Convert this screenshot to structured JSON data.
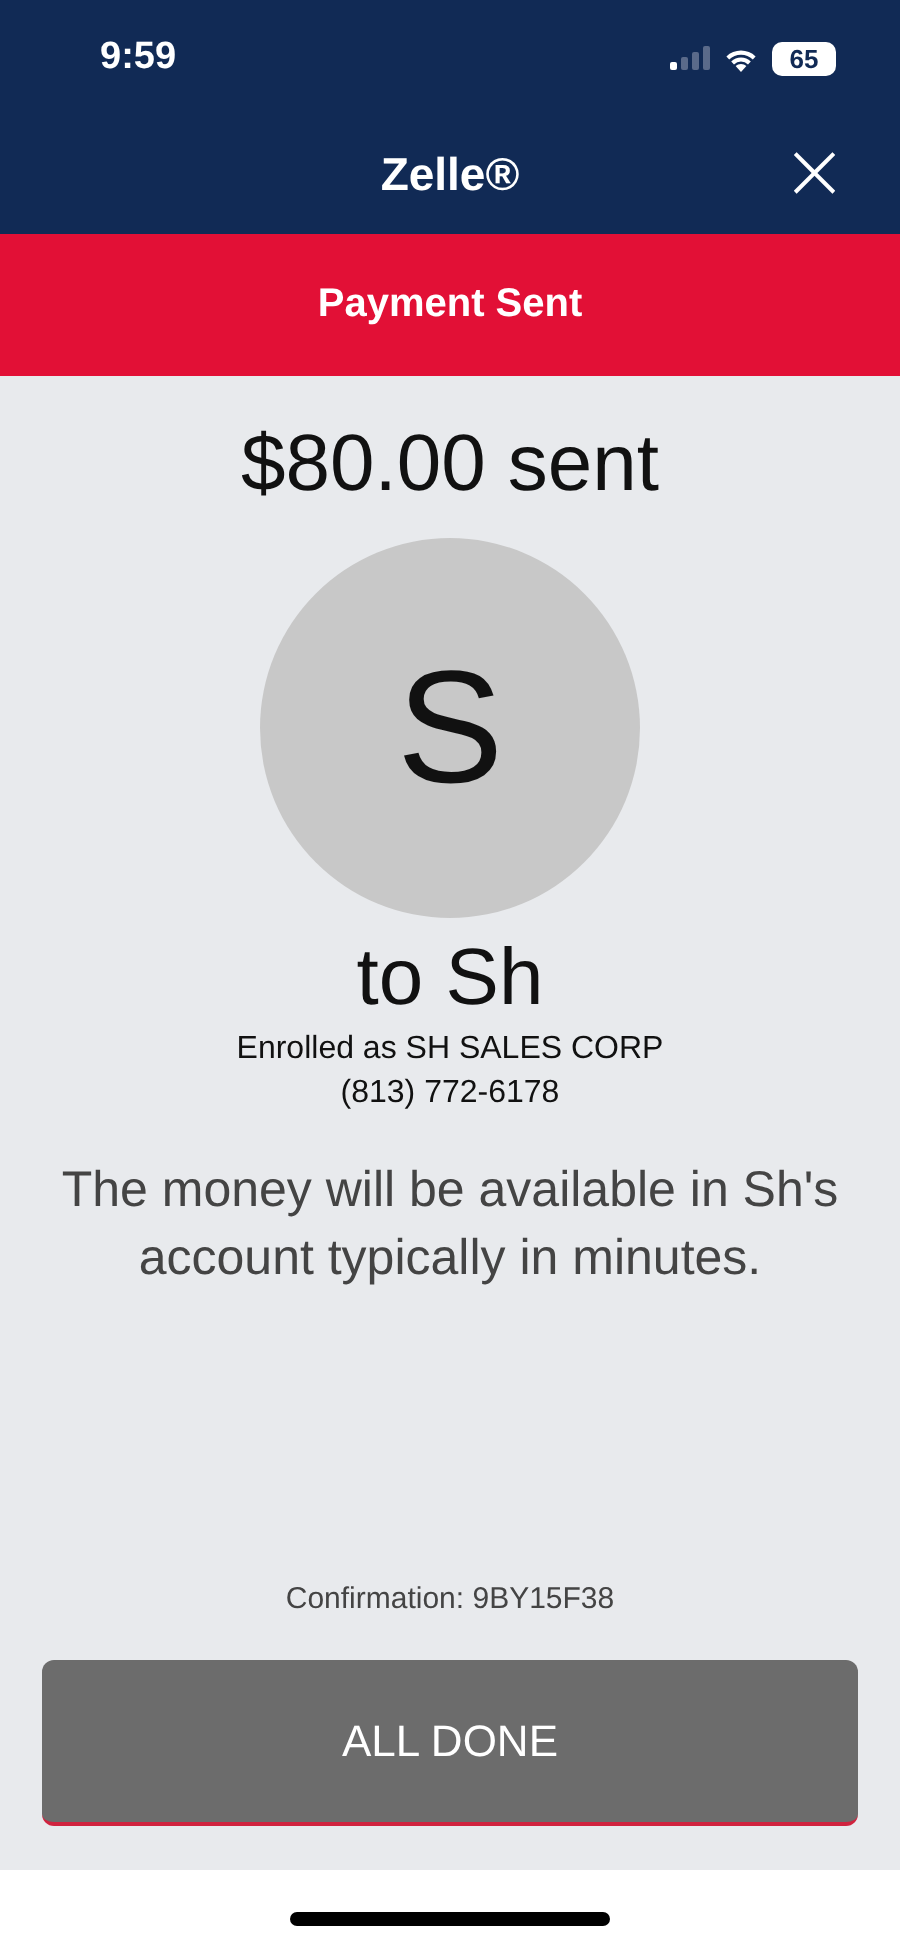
{
  "status_bar": {
    "time": "9:59",
    "battery": "65"
  },
  "header": {
    "title": "Zelle®",
    "close": "×"
  },
  "banner": {
    "text": "Payment Sent"
  },
  "amount": "$80.00 sent",
  "recipient": {
    "initial": "S",
    "name": "to Sh",
    "enrolled": "Enrolled as SH SALES CORP",
    "phone": "(813) 772-6178"
  },
  "message": "The money will be available in Sh's account typically in minutes.",
  "confirmation": "Confirmation: 9BY15F38",
  "button": "ALL DONE"
}
